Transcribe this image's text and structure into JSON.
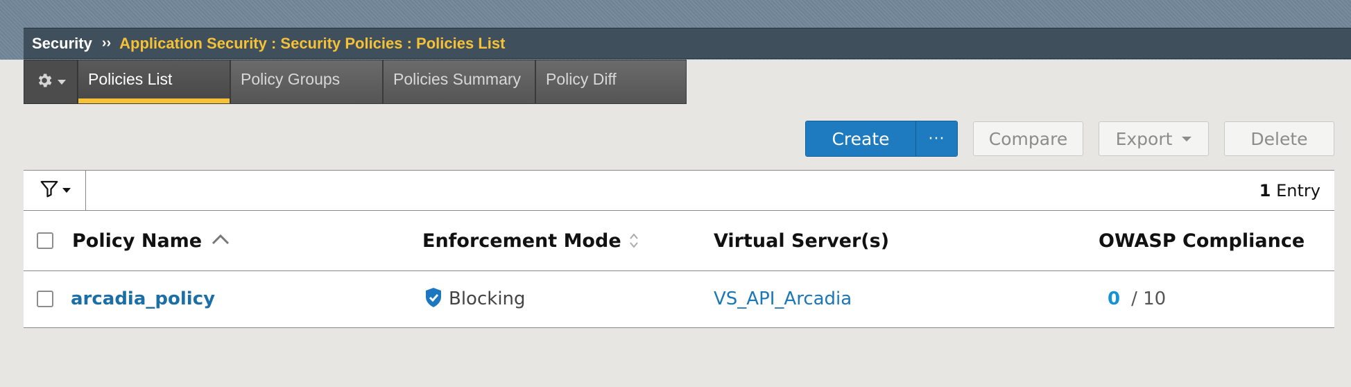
{
  "breadcrumb": {
    "root": "Security",
    "separator": "››",
    "path": "Application Security : Security Policies : Policies List"
  },
  "tabs": [
    {
      "label": "Policies List",
      "active": true
    },
    {
      "label": "Policy Groups",
      "active": false
    },
    {
      "label": "Policies Summary",
      "active": false
    },
    {
      "label": "Policy Diff",
      "active": false
    }
  ],
  "actions": {
    "create_label": "Create",
    "more_label": "···",
    "compare_label": "Compare",
    "export_label": "Export",
    "delete_label": "Delete"
  },
  "toolbar": {
    "entry_count": "1",
    "entry_label": "Entry"
  },
  "table": {
    "columns": [
      "Policy Name",
      "Enforcement Mode",
      "Virtual Server(s)",
      "OWASP Compliance"
    ],
    "rows": [
      {
        "policy_name": "arcadia_policy",
        "enforcement_mode": "Blocking",
        "virtual_server": "VS_API_Arcadia",
        "owasp_score": "0",
        "owasp_total": "/ 10"
      }
    ]
  },
  "colors": {
    "accent_tab": "#f7c136",
    "primary_button": "#1f7bbf",
    "link": "#1a77b8",
    "score": "#1592d6"
  },
  "icons": {
    "settings": "gear-icon",
    "filter": "filter-icon",
    "enforcement": "shield-check-icon",
    "sort_asc": "sort-ascending-icon",
    "sort_both": "sort-both-icon"
  }
}
